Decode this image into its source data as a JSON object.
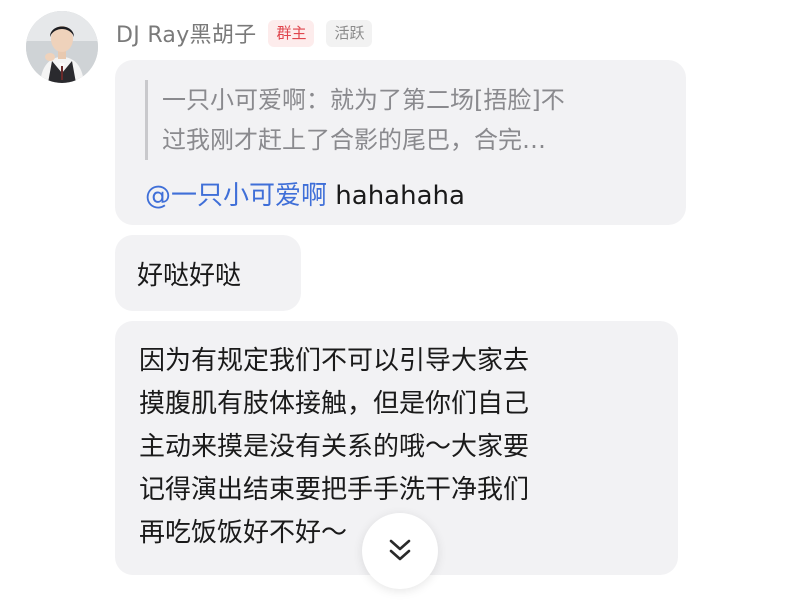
{
  "sender": {
    "name": "DJ Ray黑胡子",
    "badges": {
      "owner": "群主",
      "active": "活跃"
    },
    "avatar_icon": "person-avatar-icon"
  },
  "messages": [
    {
      "quote_lines": [
        "一只小可爱啊：就为了第二场[捂脸]不",
        "过我刚才赶上了合影的尾巴，合完…"
      ],
      "mention": "@一只小可爱啊",
      "text": " hahahaha"
    },
    {
      "text": "好哒好哒"
    },
    {
      "lines": [
        "因为有规定我们不可以引导大家去",
        "摸腹肌有肢体接触，但是你们自己",
        "主动来摸是没有关系的哦～大家要",
        "记得演出结束要把手手洗干净我们",
        "再吃饭饭好不好～"
      ]
    }
  ],
  "scroll_button": {
    "icon": "double-chevron-down-icon"
  },
  "colors": {
    "mention": "#3f6fd8",
    "owner_badge_text": "#e0454d",
    "owner_badge_bg": "#fdecec",
    "bubble_bg": "#f2f2f4"
  }
}
